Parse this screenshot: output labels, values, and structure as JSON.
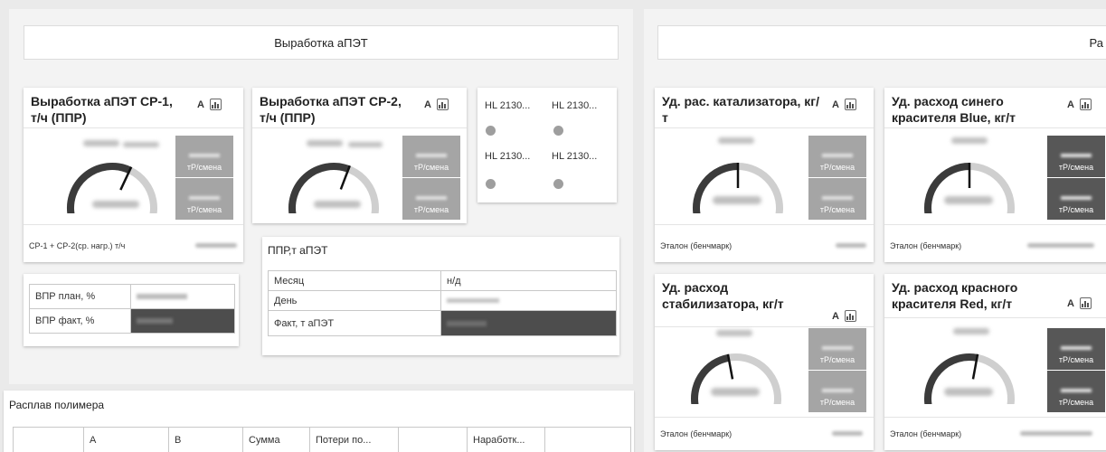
{
  "left_header": {
    "title": "Выработка аПЭТ"
  },
  "right_header": {
    "title": "Ра"
  },
  "controls": {
    "a_label": "А"
  },
  "cards": {
    "cp1": {
      "title": "Выработка аПЭТ СР-1, т/ч (ППР)",
      "box_unit": "тР/смена",
      "footer": "СР-1 + СР-2(ср. нагр.) т/ч",
      "gauge_pct": 0.62
    },
    "cp2": {
      "title": "Выработка аПЭТ СР-2, т/ч (ППР)",
      "box_unit": "тР/смена",
      "gauge_pct": 0.6
    },
    "catalyst": {
      "title": "Уд. рас. катализатора, кг/т",
      "box_unit": "тР/смена",
      "footer": "Эталон (бенчмарк)",
      "gauge_pct": 0.5
    },
    "blue": {
      "title": "Уд. расход синего красителя Blue, кг/т",
      "box_unit": "тР/смена",
      "footer": "Эталон (бенчмарк)",
      "gauge_pct": 0.5
    },
    "stabilizer": {
      "title": "Уд. расход стабилизатора, кг/т",
      "box_unit": "тР/смена",
      "footer": "Эталон (бенчмарк)",
      "gauge_pct": 0.45
    },
    "red": {
      "title": "Уд. расход красного красителя Red, кг/т",
      "box_unit": "тР/смена",
      "footer": "Эталон (бенчмарк)",
      "gauge_pct": 0.55
    }
  },
  "hl": {
    "items": [
      "HL 2130...",
      "HL 2130...",
      "HL 2130...",
      "HL 2130..."
    ]
  },
  "vpr": {
    "plan_label": "ВПР план, %",
    "fact_label": "ВПР факт, %"
  },
  "ppr": {
    "title": "ППР,т аПЭТ",
    "rows": [
      {
        "label": "Месяц",
        "value": "н/д"
      },
      {
        "label": "День",
        "value": ""
      },
      {
        "label": "Факт, т аПЭТ",
        "value": ""
      }
    ]
  },
  "melt": {
    "title": "Расплав полимера",
    "columns": [
      "",
      "А",
      "В",
      "Сумма",
      "Потери по...",
      "",
      "Наработк...",
      ""
    ]
  }
}
